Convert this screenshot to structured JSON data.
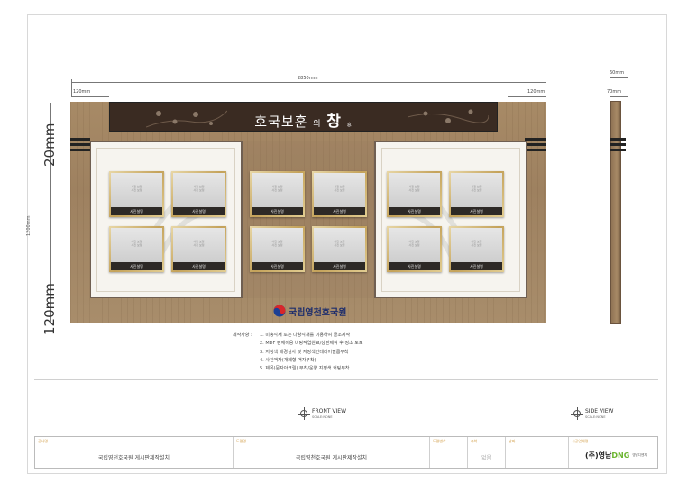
{
  "dimensions": {
    "total_width": "2850mm",
    "side_width": "60mm",
    "left_margin": "120mm",
    "right_margin": "120mm",
    "side_small": "70mm",
    "top_vertical": "20mm",
    "bottom_vertical": "120mm",
    "height_small": "1200mm"
  },
  "header": {
    "title_part1": "호국보훈",
    "title_part2": "의",
    "title_part3": "창",
    "title_hanja": "窓"
  },
  "frames": {
    "placeholder_line1": "사진 보정",
    "placeholder_line2": "사진 보정",
    "caption": "사진설명"
  },
  "logo": {
    "text": "국립영천호국원",
    "colors": {
      "red": "#d7262b",
      "blue": "#1c3f94"
    }
  },
  "notes": {
    "label": "제작사항 :",
    "items": [
      "1. 미송각재 또는 나왕각재를 이용하여 골조제작",
      "2. MDF 판재이용 바탕작업완료/상판제작 후 정소 도포",
      "3. 지정색 배경실사 및 지정색인테리어필름부착",
      "4. 사진액자(개폐형 액자부착)",
      "5. 제목(문자아크릴) 부착/운양 지정색 커팅부착"
    ]
  },
  "views": {
    "front": {
      "label": "FRONT VIEW",
      "scale": "SCALE:NONE"
    },
    "side": {
      "label": "SIDE VIEW",
      "scale": "SCALE:NONE"
    }
  },
  "title_block": {
    "cells": [
      {
        "label": "공사명",
        "value": "국립영천호국원 게시판제작설치"
      },
      {
        "label": "도면명",
        "value": "국립영천호국원 게시판제작설치"
      },
      {
        "label": "도면번호",
        "value": ""
      },
      {
        "label": "축척",
        "value": "없음"
      },
      {
        "label": "날짜",
        "value": ""
      },
      {
        "label": "시공업체명",
        "value": ""
      }
    ],
    "company": {
      "prefix": "(주)영남",
      "brand": "DNG",
      "sub": "영남디엔지"
    }
  },
  "colors": {
    "board": "#a78a66",
    "header": "#3a2b22",
    "frame_gold": "#c4a25a",
    "label_orange": "#d4a352"
  }
}
